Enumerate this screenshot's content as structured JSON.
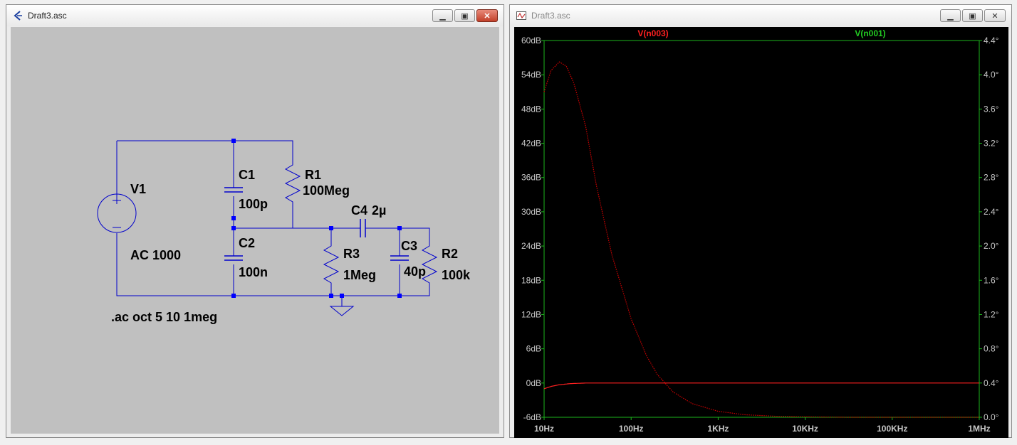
{
  "schematic_window": {
    "title": "Draft3.asc",
    "components": {
      "v1_name": "V1",
      "v1_value": "AC 1000",
      "c1_name": "C1",
      "c1_value": "100p",
      "r1_name": "R1",
      "r1_value": "100Meg",
      "c2_name": "C2",
      "c2_value": "100n",
      "c4_name": "C4",
      "c4_value": "2µ",
      "r3_name": "R3",
      "r3_value": "1Meg",
      "c3_name": "C3",
      "c3_value": "40p",
      "r2_name": "R2",
      "r2_value": "100k"
    },
    "directive": ".ac oct 5 10 1meg",
    "colors": {
      "background": "#c0c0c0",
      "wire": "#0000cc",
      "junction": "#0000ff",
      "text": "#000000"
    }
  },
  "plot_window": {
    "title": "Draft3.asc",
    "colors": {
      "background": "#000000",
      "frame": "#1db31d",
      "trace_mag": "#ff2020",
      "trace_phase": "#cc0000",
      "axis_text": "#c8c8c8",
      "legend_red": "#ff2020",
      "legend_green": "#22cc22"
    }
  },
  "chart_data": {
    "type": "line",
    "legend": [
      "V(n003)",
      "V(n001)"
    ],
    "x_scale": "log",
    "xlim_hz": [
      10,
      1000000
    ],
    "x_ticks": [
      "10Hz",
      "100Hz",
      "1KHz",
      "10KHz",
      "100KHz",
      "1MHz"
    ],
    "ylim_db": [
      -6,
      60
    ],
    "y_ticks": [
      "60dB",
      "54dB",
      "48dB",
      "42dB",
      "36dB",
      "30dB",
      "24dB",
      "18dB",
      "12dB",
      "6dB",
      "0dB",
      "-6dB"
    ],
    "ylim_right_deg": [
      0.0,
      4.4
    ],
    "y_ticks_right": [
      "4.4°",
      "4.0°",
      "3.6°",
      "3.2°",
      "2.8°",
      "2.4°",
      "2.0°",
      "1.6°",
      "1.2°",
      "0.8°",
      "0.4°",
      "0.0°"
    ],
    "series": [
      {
        "name": "V(n003)",
        "axis": "left",
        "points_hz_db": [
          [
            10,
            -1
          ],
          [
            12,
            -0.6
          ],
          [
            15,
            -0.3
          ],
          [
            20,
            -0.1
          ],
          [
            30,
            0
          ],
          [
            50,
            0
          ],
          [
            100,
            0
          ],
          [
            1000,
            0
          ],
          [
            1000000,
            0
          ]
        ]
      },
      {
        "name": "V(n001)",
        "axis": "right",
        "points_hz_deg": [
          [
            10,
            3.8
          ],
          [
            12,
            4.05
          ],
          [
            15,
            4.15
          ],
          [
            18,
            4.1
          ],
          [
            22,
            3.9
          ],
          [
            30,
            3.4
          ],
          [
            40,
            2.7
          ],
          [
            60,
            1.9
          ],
          [
            100,
            1.15
          ],
          [
            150,
            0.72
          ],
          [
            200,
            0.5
          ],
          [
            300,
            0.3
          ],
          [
            500,
            0.16
          ],
          [
            1000,
            0.07
          ],
          [
            2000,
            0.03
          ],
          [
            5000,
            0.01
          ],
          [
            10000,
            0.005
          ],
          [
            30000,
            0.0
          ],
          [
            1000000,
            0.0
          ]
        ]
      }
    ]
  }
}
